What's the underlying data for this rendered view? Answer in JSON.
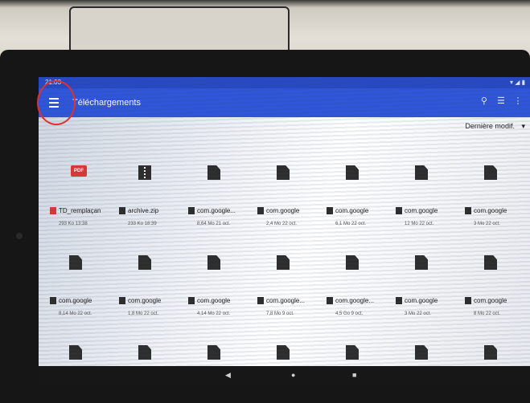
{
  "status_bar": {
    "time": "21:03",
    "indicators": "▾ ◢ ▮"
  },
  "app_bar": {
    "title": "Téléchargements",
    "icons": [
      "search-icon",
      "view-toggle-icon",
      "more-icon"
    ]
  },
  "sort": {
    "label": "Dernière modif.",
    "caret": "▾"
  },
  "files": [
    {
      "name": "TD_remplaçan",
      "info": "293 Ko 13:38",
      "type": "pdf"
    },
    {
      "name": "archive.zip",
      "info": "233 Ko 18:39",
      "type": "zip"
    },
    {
      "name": "com.google...",
      "info": "8,64 Mo 21 oct.",
      "type": "file"
    },
    {
      "name": "com.google",
      "info": "2,4 Mo 22 oct.",
      "type": "file"
    },
    {
      "name": "com.google",
      "info": "6,1 Mo 22 oct.",
      "type": "file"
    },
    {
      "name": "com.google",
      "info": "12 Mo 22 oct.",
      "type": "file"
    },
    {
      "name": "com.google",
      "info": "3 Mo 22 oct.",
      "type": "file"
    },
    {
      "name": "com.google",
      "info": "8,14 Mo 22 oct.",
      "type": "file"
    },
    {
      "name": "com.google",
      "info": "1,8 Mo 22 oct.",
      "type": "file"
    },
    {
      "name": "com.google",
      "info": "4,14 Mo 22 oct.",
      "type": "file"
    },
    {
      "name": "com.google...",
      "info": "7,8 Mo 9 oct.",
      "type": "file"
    },
    {
      "name": "com.google...",
      "info": "4,5 Go 9 oct.",
      "type": "file"
    },
    {
      "name": "com.google",
      "info": "3 Mo 22 oct.",
      "type": "file"
    },
    {
      "name": "com.google",
      "info": "8 Mo 22 oct.",
      "type": "file"
    },
    {
      "name": "",
      "info": "",
      "type": "file"
    },
    {
      "name": "",
      "info": "",
      "type": "file"
    },
    {
      "name": "",
      "info": "",
      "type": "file"
    },
    {
      "name": "",
      "info": "",
      "type": "file"
    },
    {
      "name": "",
      "info": "",
      "type": "file"
    },
    {
      "name": "",
      "info": "",
      "type": "file"
    },
    {
      "name": "",
      "info": "",
      "type": "file"
    }
  ],
  "pdf_badge": "PDF",
  "nav_bar": {
    "back": "◀",
    "home": "●",
    "recent": "■"
  },
  "colors": {
    "app_bar": "#2f56d9",
    "status_bar": "#2749c4",
    "annotation": "#e0302f"
  }
}
